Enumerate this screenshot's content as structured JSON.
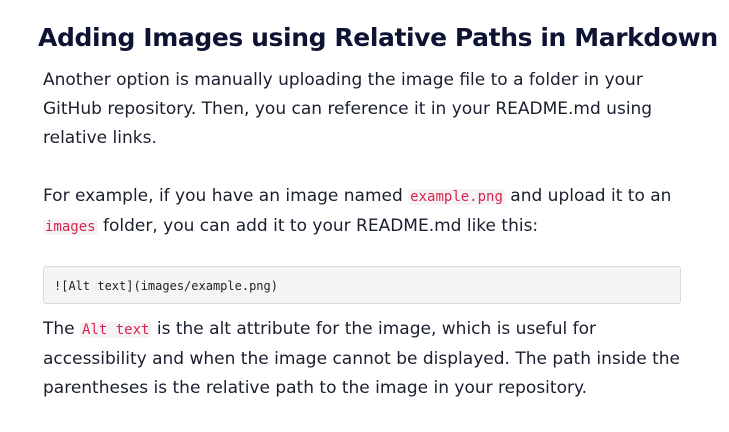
{
  "heading": "Adding Images using Relative Paths in Markdown",
  "paragraph1": {
    "text": "Another option is manually uploading the image file to a folder in your GitHub repository. Then, you can reference it in your README.md using relative links."
  },
  "paragraph2": {
    "part1": "For example, if you have an image named ",
    "code1": "example.png",
    "part2": " and upload it to an ",
    "code2": "images",
    "part3": " folder, you can add it to your README.md like this:"
  },
  "code_block": "![Alt text](images/example.png)",
  "paragraph3": {
    "part1": "The ",
    "code1": "Alt text",
    "part2": " is the alt attribute for the image, which is useful for accessibility and when the image cannot be displayed. The path inside the parentheses is the relative path to the image in your repository."
  },
  "colors": {
    "heading": "#0d1433",
    "body_text": "#1a1f2e",
    "inline_code": "#d6264e",
    "code_block_bg": "#f5f5f5",
    "code_block_border": "#d8d8d8"
  }
}
